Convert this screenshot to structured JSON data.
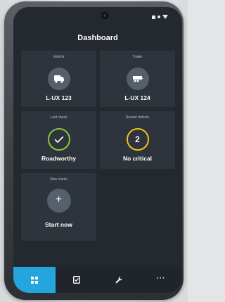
{
  "header": {
    "title": "Dashboard",
    "status_icons": [
      "square-icon",
      "dot-icon",
      "signal-triangle-icon"
    ]
  },
  "cards": {
    "vehicle": {
      "label": "Vehicle",
      "value": "L-UX 123",
      "icon": "truck-icon"
    },
    "trailer": {
      "label": "Trailer",
      "value": "L-UX 124",
      "icon": "trailer-icon"
    },
    "last_check": {
      "label": "Last check",
      "value": "Roadworthy",
      "icon": "check-icon",
      "ring_color": "#8dc63f"
    },
    "recent_defects": {
      "label": "Recent defects",
      "count": "2",
      "value": "No critical",
      "ring_color": "#f3c21b"
    },
    "new_check": {
      "label": "New check",
      "value": "Start now",
      "icon": "plus-icon"
    }
  },
  "navbar": {
    "items": [
      {
        "icon": "grid-icon",
        "active": true
      },
      {
        "icon": "checklist-icon",
        "active": false
      },
      {
        "icon": "wrench-icon",
        "active": false
      },
      {
        "icon": "more-icon",
        "label": "···",
        "active": false
      }
    ],
    "accent": "#22a6dd"
  },
  "colors": {
    "screen_bg": "#23292f",
    "card_bg": "#2d343b"
  }
}
